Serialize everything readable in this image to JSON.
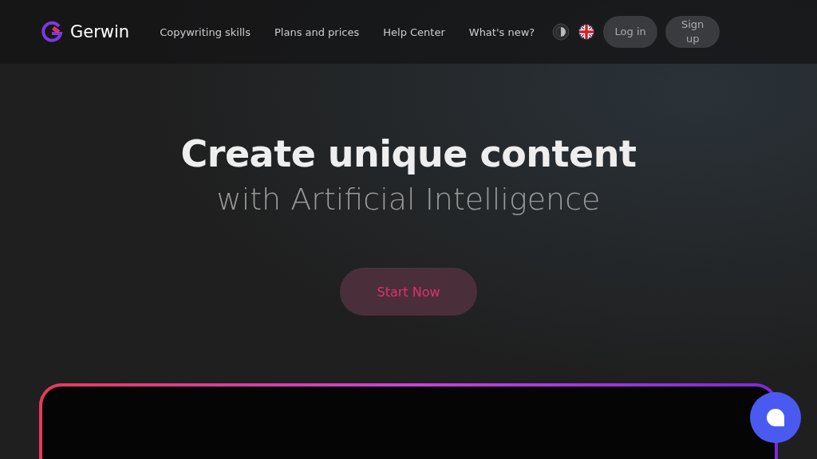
{
  "header": {
    "brand": "Gerwin",
    "nav": [
      {
        "label": "Copywriting skills"
      },
      {
        "label": "Plans and prices"
      },
      {
        "label": "Help Center"
      },
      {
        "label": "What's new?"
      }
    ],
    "login": "Log in",
    "signup": "Sign up"
  },
  "hero": {
    "title": "Create unique content",
    "subtitle": "with Artificial Intelligence",
    "cta": "Start Now"
  }
}
